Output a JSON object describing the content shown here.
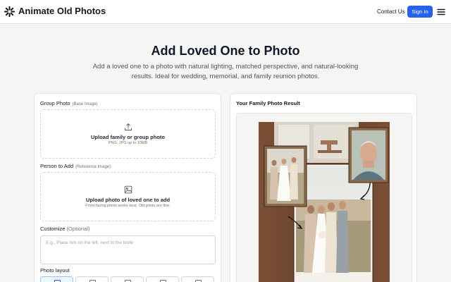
{
  "header": {
    "brand": "Animate Old Photos",
    "contact_label": "Contact Us",
    "signin_label": "Sign In",
    "logo_icon": "sparkle-burst-icon",
    "menu_icon": "hamburger-menu-icon"
  },
  "hero": {
    "title": "Add Loved One to Photo",
    "subtitle": "Add a loved one to a photo with natural lighting, matched perspective, and natural-looking results. Ideal for wedding, memorial, and family reunion photos."
  },
  "form": {
    "group_photo": {
      "label": "Group Photo",
      "hint": "(Base Image)",
      "upload_title": "Upload family or group photo",
      "upload_sub": "PNG, JPG up to 10MB",
      "icon": "upload-icon"
    },
    "person": {
      "label": "Person to Add",
      "hint": "(Reference Image)",
      "upload_title": "Upload photo of loved one to add",
      "upload_sub": "Front-facing photo works best. Old prints are fine.",
      "icon": "image-icon"
    },
    "customize": {
      "label": "Customize",
      "hint": "(Optional)",
      "placeholder": "E.g., Place him on the left, next to the bride",
      "value": ""
    },
    "layout": {
      "label": "Photo layout",
      "options": [
        "layout-1",
        "layout-2",
        "layout-3",
        "layout-4",
        "layout-5"
      ],
      "selected_index": 0
    }
  },
  "result": {
    "title": "Your Family Photo Result"
  },
  "colors": {
    "accent": "#2563eb",
    "page_bg": "#f5f5f4",
    "card_bg": "#ffffff",
    "frame_wood": "#6b4530"
  }
}
